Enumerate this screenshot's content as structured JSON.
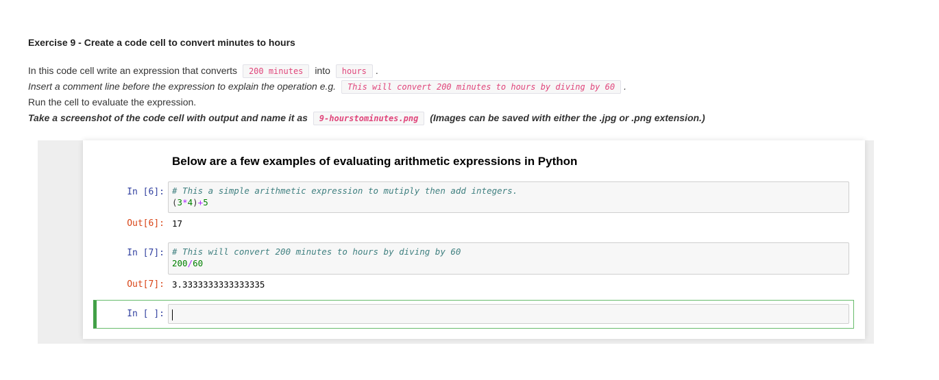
{
  "exercise": {
    "title": "Exercise 9 - Create a code cell to convert minutes to hours",
    "line1": {
      "before": "In this code cell write an expression that converts",
      "code1": "200 minutes",
      "middle": "into",
      "code2": "hours",
      "after": "."
    },
    "line2": {
      "before": "Insert a comment line before the expression to explain the operation e.g.",
      "code": "This will convert 200 minutes to hours by diving by 60",
      "after": "."
    },
    "line3": "Run the cell to evaluate the expression.",
    "line4": {
      "before": "Take a screenshot of the code cell with output and name it as",
      "code": "9-hourstominutes.png",
      "after": "(Images can be saved with either the .jpg or .png extension.)"
    }
  },
  "notebook": {
    "heading": "Below are a few examples of evaluating arithmetic expressions in Python",
    "cells": [
      {
        "in_prompt": "In [6]:",
        "comment": "#  This a simple arithmetic expression to mutiply then add integers.",
        "code_parts": [
          "(",
          "3",
          "*",
          "4",
          ")",
          "+",
          "5"
        ],
        "out_prompt": "Out[6]:",
        "output": "17"
      },
      {
        "in_prompt": "In [7]:",
        "comment": "# This will convert 200 minutes to hours by diving by 60",
        "code_parts": [
          "200",
          "/",
          "60"
        ],
        "out_prompt": "Out[7]:",
        "output": "3.3333333333333335"
      },
      {
        "in_prompt": "In [ ]:"
      }
    ]
  }
}
